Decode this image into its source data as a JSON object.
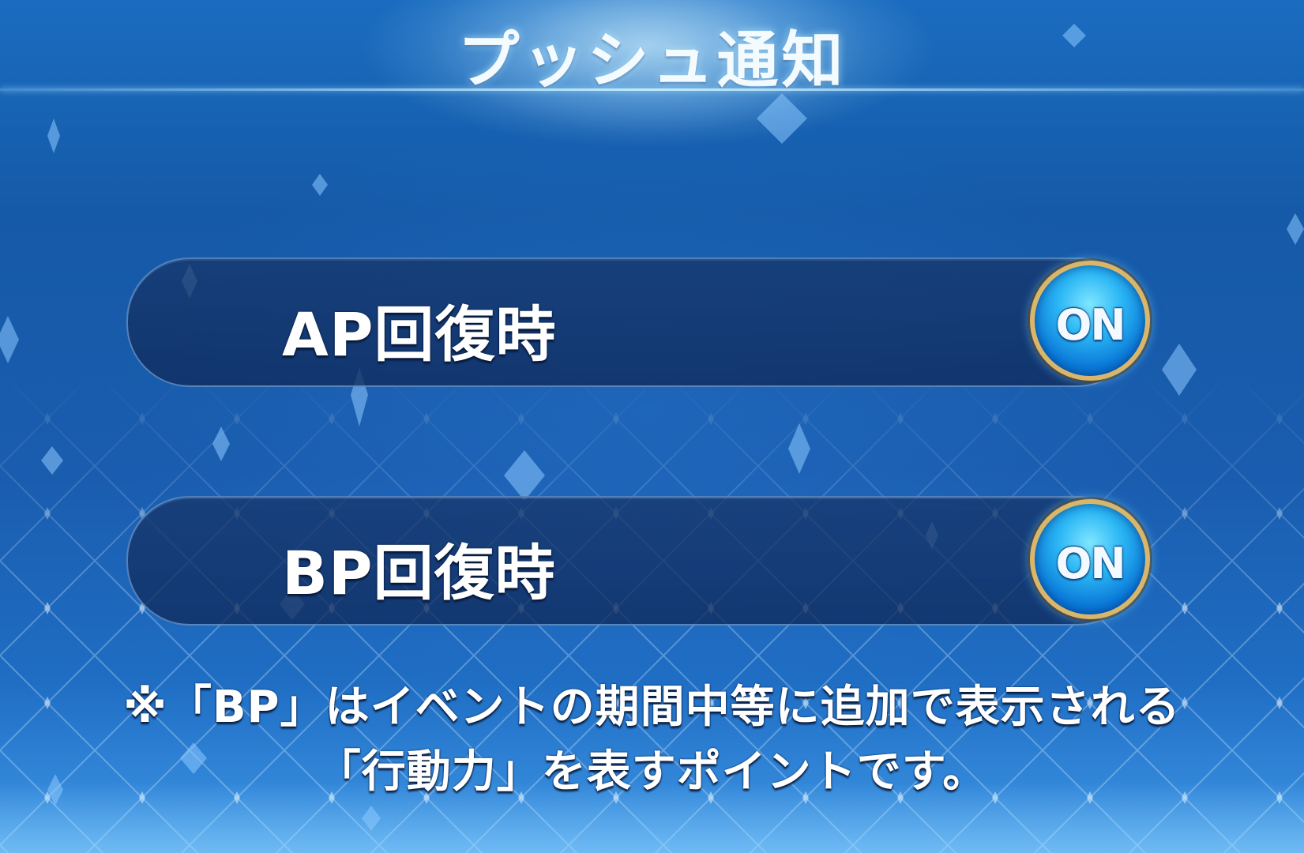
{
  "header": {
    "title": "プッシュ通知"
  },
  "settings": [
    {
      "label": "AP回復時",
      "toggle_label": "ON",
      "enabled": true
    },
    {
      "label": "BP回復時",
      "toggle_label": "ON",
      "enabled": true
    }
  ],
  "note": {
    "line1": "※「BP」はイベントの期間中等に追加で表示される",
    "line2": "「行動力」を表すポイントです。"
  },
  "colors": {
    "background": "#1a5cae",
    "toggle_border": "#d9b66a",
    "toggle_fill": "#2bb6f4",
    "row_fill": "#163466"
  }
}
